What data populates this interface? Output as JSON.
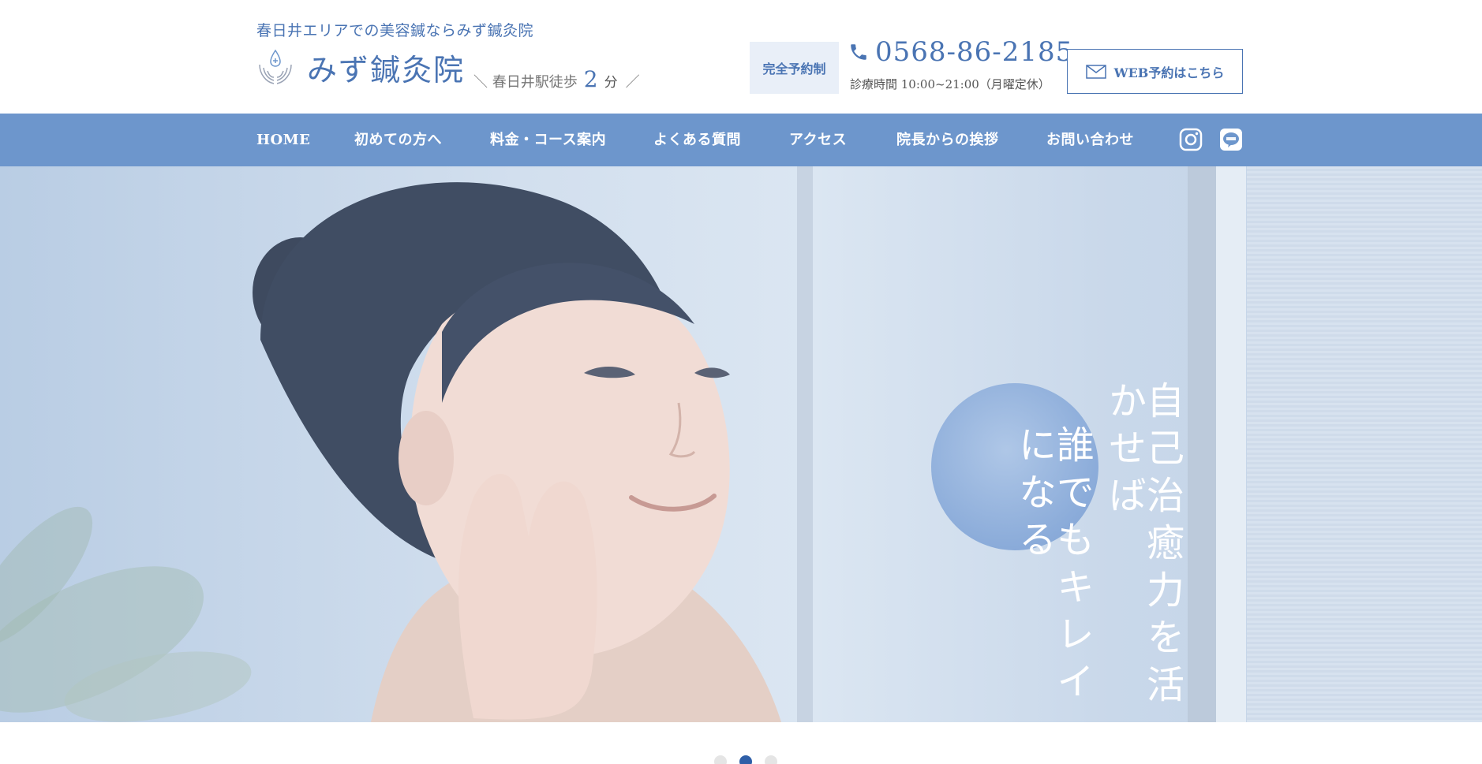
{
  "header": {
    "tagline": "春日井エリアでの美容鍼ならみず鍼灸院",
    "logo_name": "みず鍼灸院",
    "access": {
      "prefix": "＼ 春日井駅徒歩",
      "number": "2",
      "suffix": "分",
      "end": "／"
    },
    "reserve_badge": "完全予約制",
    "phone": "0568-86-2185",
    "hours": "診療時間 10:00~21:00（月曜定休）",
    "web_button": "WEB予約はこちら"
  },
  "nav": {
    "items": [
      "HOME",
      "初めての方へ",
      "料金・コース案内",
      "よくある質問",
      "アクセス",
      "院長からの挨拶",
      "お問い合わせ"
    ],
    "social": [
      "instagram-icon",
      "line-icon"
    ]
  },
  "hero": {
    "line1": "自己治癒力を活かせば",
    "line2": "誰でもキレイになる"
  },
  "slider": {
    "count": 3,
    "active": 2
  },
  "colors": {
    "brand": "#4a74b3",
    "nav_bg": "#6d96cc",
    "badge_bg": "#e9eff8",
    "dot_active": "#2f5fa8",
    "dot_inactive": "#e5e5e5"
  }
}
